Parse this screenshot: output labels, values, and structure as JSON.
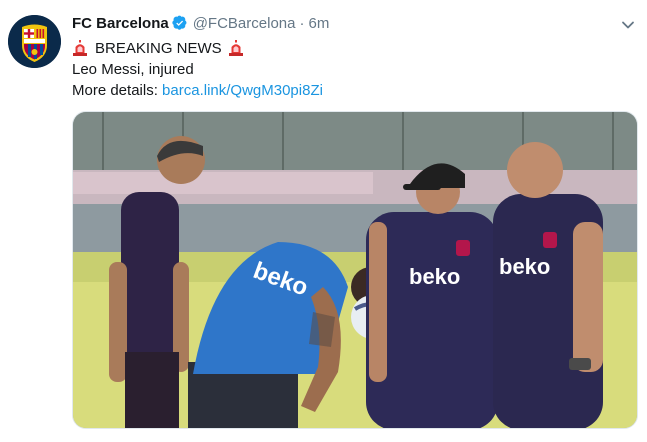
{
  "tweet": {
    "author_name": "FC Barcelona",
    "handle": "@FCBarcelona",
    "separator": "·",
    "time": "6m",
    "line1": "BREAKING NEWS",
    "line2": "Leo Messi, injured",
    "line3_prefix": "More details: ",
    "link_text": "barca.link/QwgM30pi8Zi"
  },
  "photo": {
    "shirt_sponsor": "beko"
  },
  "colors": {
    "link": "#1b95e0",
    "verified": "#1da1f2",
    "secondary_text": "#657786"
  },
  "icons": {
    "verified": "verified-badge-icon",
    "siren": "rotating-light-icon",
    "menu": "chevron-down-icon"
  }
}
